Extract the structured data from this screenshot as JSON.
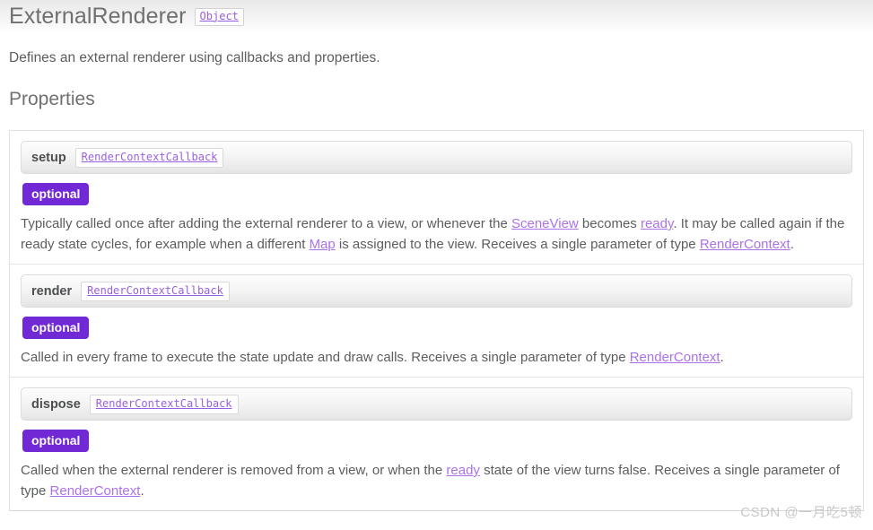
{
  "header": {
    "title": "ExternalRenderer",
    "type_badge": "Object"
  },
  "intro": "Defines an external renderer using callbacks and properties.",
  "section_heading": "Properties",
  "badges": {
    "optional": "optional",
    "optional_color": "#7029d4"
  },
  "link_color": "#ab72ea",
  "properties": [
    {
      "name": "setup",
      "type": "RenderContextCallback",
      "flag": "optional",
      "description_parts": [
        {
          "text": "Typically called once after adding the external renderer to a view, or whenever the ",
          "link": false
        },
        {
          "text": "SceneView",
          "link": true
        },
        {
          "text": " becomes ",
          "link": false
        },
        {
          "text": "ready",
          "link": true
        },
        {
          "text": ". It may be called again if the ready state cycles, for example when a different ",
          "link": false
        },
        {
          "text": "Map",
          "link": true
        },
        {
          "text": " is assigned to the view. Receives a single parameter of type ",
          "link": false
        },
        {
          "text": "RenderContext",
          "link": true
        },
        {
          "text": ".",
          "link": false
        }
      ]
    },
    {
      "name": "render",
      "type": "RenderContextCallback",
      "flag": "optional",
      "description_parts": [
        {
          "text": "Called in every frame to execute the state update and draw calls. Receives a single parameter of type ",
          "link": false
        },
        {
          "text": "RenderContext",
          "link": true
        },
        {
          "text": ".",
          "link": false
        }
      ]
    },
    {
      "name": "dispose",
      "type": "RenderContextCallback",
      "flag": "optional",
      "description_parts": [
        {
          "text": "Called when the external renderer is removed from a view, or when the ",
          "link": false
        },
        {
          "text": "ready",
          "link": true
        },
        {
          "text": " state of the view turns false. Receives a single parameter of type ",
          "link": false
        },
        {
          "text": "RenderContext",
          "link": true
        },
        {
          "text": ".",
          "link": false
        }
      ]
    }
  ],
  "watermark": "CSDN @一月吃5顿"
}
